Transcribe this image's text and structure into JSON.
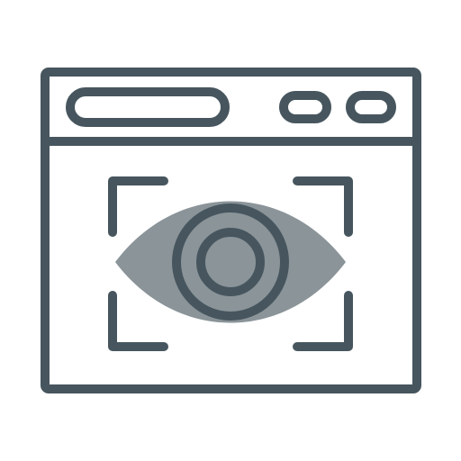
{
  "icon": {
    "name": "browser-eye-scan-icon",
    "colors": {
      "stroke": "#47565e",
      "eye_fill": "#8a9499",
      "background": "#ffffff"
    },
    "parts": [
      "browser-window-icon",
      "address-bar-icon",
      "window-control-icon",
      "focus-frame-icon",
      "eye-icon",
      "iris-icon",
      "pupil-icon"
    ]
  }
}
